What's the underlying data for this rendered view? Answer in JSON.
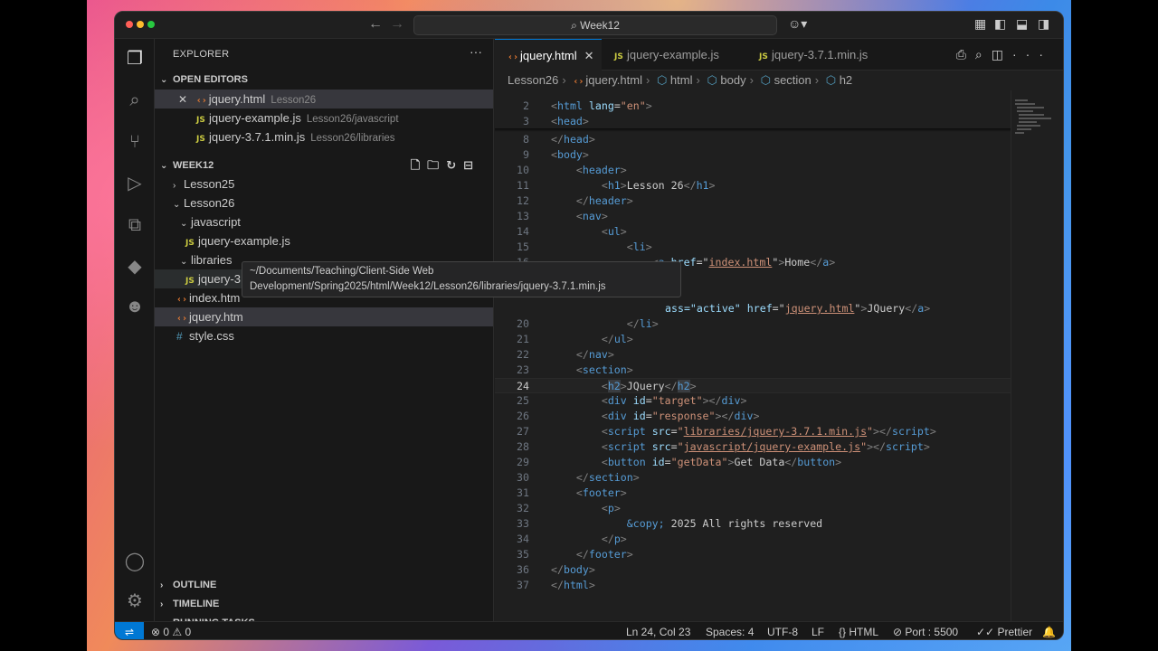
{
  "window": {
    "search": "Week12"
  },
  "explorer": {
    "title": "EXPLORER",
    "open_editors_label": "OPEN EDITORS",
    "open_editors": [
      {
        "name": "jquery.html",
        "path": "Lesson26",
        "icon": "html-icon"
      },
      {
        "name": "jquery-example.js",
        "path": "Lesson26/javascript",
        "icon": "js-icon"
      },
      {
        "name": "jquery-3.7.1.min.js",
        "path": "Lesson26/libraries",
        "icon": "js-icon"
      }
    ],
    "folder_label": "WEEK12",
    "tree": [
      {
        "name": "Lesson25"
      },
      {
        "name": "Lesson26"
      },
      {
        "name": "javascript"
      },
      {
        "name": "jquery-example.js"
      },
      {
        "name": "libraries"
      },
      {
        "name": "jquery-3.7.1.min.js"
      },
      {
        "name": "index.htm"
      },
      {
        "name": "jquery.htm"
      },
      {
        "name": "style.css"
      }
    ],
    "tooltip_line1": "~/Documents/Teaching/Client-Side Web",
    "tooltip_line2": "Development/Spring2025/html/Week12/Lesson26/libraries/jquery-3.7.1.min.js",
    "outline_label": "OUTLINE",
    "timeline_label": "TIMELINE",
    "running_tasks_label": "RUNNING TASKS"
  },
  "tabs": [
    {
      "label": "jquery.html"
    },
    {
      "label": "jquery-example.js"
    },
    {
      "label": "jquery-3.7.1.min.js"
    }
  ],
  "breadcrumb": [
    "Lesson26",
    "jquery.html",
    "html",
    "body",
    "section",
    "h2"
  ],
  "code_lines": [
    {
      "n": "2"
    },
    {
      "n": "3"
    },
    {
      "n": "8"
    },
    {
      "n": "9"
    },
    {
      "n": "10"
    },
    {
      "n": "11"
    },
    {
      "n": "12"
    },
    {
      "n": "13"
    },
    {
      "n": "14"
    },
    {
      "n": "15"
    },
    {
      "n": "16"
    },
    {
      "n": "17"
    },
    {
      "n": "20"
    },
    {
      "n": "21"
    },
    {
      "n": "22"
    },
    {
      "n": "23"
    },
    {
      "n": "24"
    },
    {
      "n": "25"
    },
    {
      "n": "26"
    },
    {
      "n": "27"
    },
    {
      "n": "28"
    },
    {
      "n": "29"
    },
    {
      "n": "30"
    },
    {
      "n": "31"
    },
    {
      "n": "32"
    },
    {
      "n": "33"
    },
    {
      "n": "34"
    },
    {
      "n": "35"
    },
    {
      "n": "36"
    },
    {
      "n": "37"
    }
  ],
  "code": {
    "l2_lang": "\"en\"",
    "l11_text": "Lesson 26",
    "l16_href": "index.html",
    "l16_text": "Home",
    "l18_class_tail": "ass=\"active\"",
    "l18_href": "jquery.html",
    "l18_text": "JQuery",
    "l24_text": "JQuery",
    "l25_id": "\"target\"",
    "l26_id": "\"response\"",
    "l27_src": "libraries/jquery-3.7.1.min.js",
    "l28_src": "javascript/jquery-example.js",
    "l29_id": "\"getData\"",
    "l29_text": "Get Data",
    "l33_entity": "&copy;",
    "l33_text": " 2025 All rights reserved"
  },
  "status": {
    "errors": "0",
    "warnings": "0",
    "position": "Ln 24, Col 23",
    "spaces": "Spaces: 4",
    "encoding": "UTF-8",
    "eol": "LF",
    "language": "HTML",
    "port": "Port : 5500",
    "prettier": "Prettier"
  }
}
